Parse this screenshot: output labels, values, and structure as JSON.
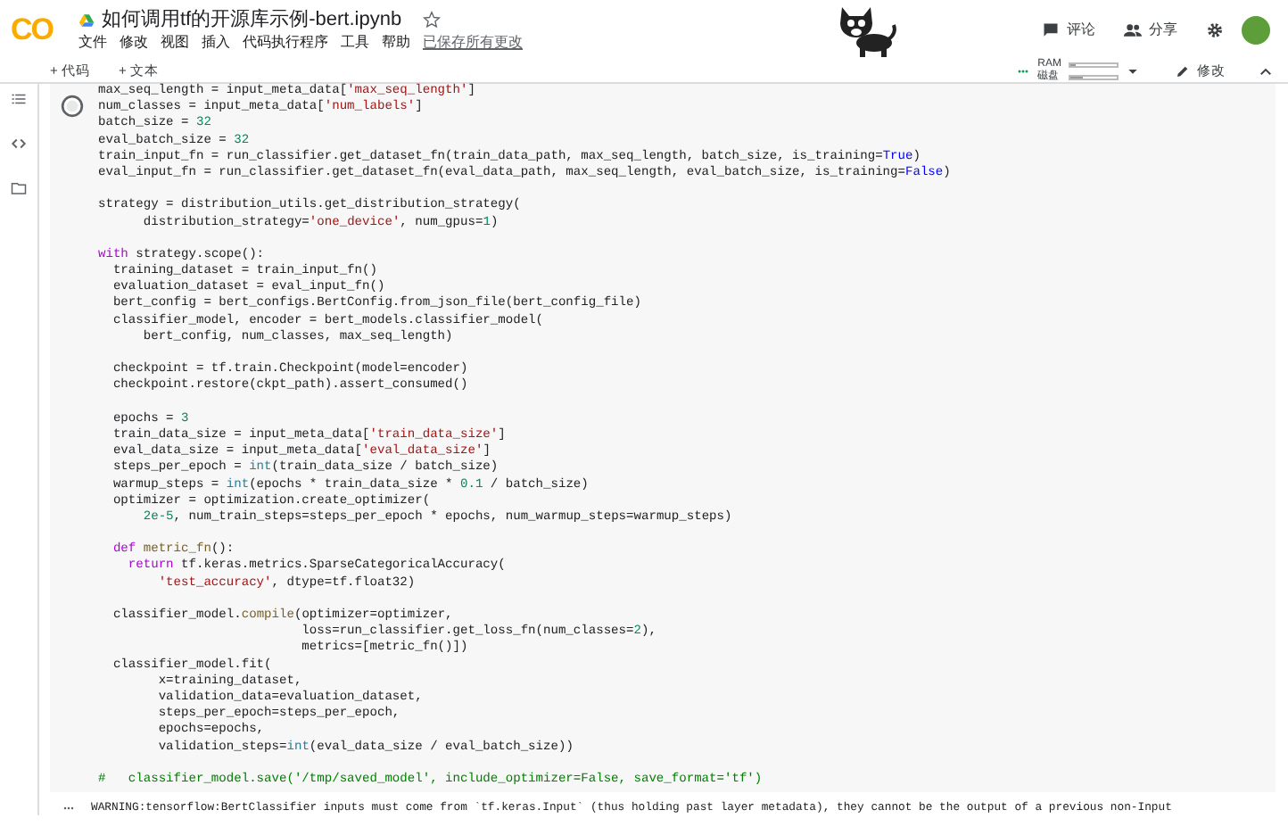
{
  "header": {
    "logo": "CO",
    "title": "如何调用tf的开源库示例-bert.ipynb",
    "starred": false,
    "menu": [
      "文件",
      "修改",
      "视图",
      "插入",
      "代码执行程序",
      "工具",
      "帮助"
    ],
    "save_status": "已保存所有更改",
    "actions": [
      "评论",
      "分享"
    ]
  },
  "toolbar": {
    "add": [
      "+ 代码",
      "+ 文本"
    ],
    "ram": {
      "label": "RAM",
      "level": 0.1
    },
    "disk": {
      "label": "磁盘",
      "level": 0.25
    },
    "edit": "修改"
  },
  "cell": {
    "blocks": [
      [
        [
          "max_seq_length = input_meta_data[",
          {
            "text": "'max_seq_length'",
            "kind": "str"
          },
          "]"
        ],
        [
          "num_classes = input_meta_data[",
          {
            "text": "'num_labels'",
            "kind": "str"
          },
          "]"
        ],
        [
          "batch_size = ",
          {
            "text": "32",
            "kind": "num"
          }
        ],
        [
          "eval_batch_size = ",
          {
            "text": "32",
            "kind": "num"
          }
        ],
        [
          "train_input_fn = run_classifier.get_dataset_fn(train_data_path, max_seq_length, batch_size, is_training=",
          {
            "text": "True",
            "kind": "const"
          },
          ")"
        ],
        [
          "eval_input_fn = run_classifier.get_dataset_fn(eval_data_path, max_seq_length, eval_batch_size, is_training=",
          {
            "text": "False",
            "kind": "const"
          },
          ")"
        ]
      ],
      [
        [
          "strategy = distribution_utils.get_distribution_strategy("
        ],
        [
          "      distribution_strategy=",
          {
            "text": "'one_device'",
            "kind": "str"
          },
          ", num_gpus=",
          {
            "text": "1",
            "kind": "num"
          },
          ")"
        ]
      ],
      [
        [
          {
            "text": "with",
            "kind": "kw"
          },
          " strategy.scope():"
        ],
        [
          "  training_dataset = train_input_fn()"
        ],
        [
          "  evaluation_dataset = eval_input_fn()"
        ],
        [
          "  bert_config = bert_configs.BertConfig.from_json_file(bert_config_file)"
        ],
        [
          "  classifier_model, encoder = bert_models.classifier_model("
        ],
        [
          "      bert_config, num_classes, max_seq_length)"
        ]
      ],
      [
        [
          "  checkpoint = tf.train.Checkpoint(model=encoder)"
        ],
        [
          "  checkpoint.restore(ckpt_path).assert_consumed()"
        ]
      ],
      [
        [
          "  epochs = ",
          {
            "text": "3",
            "kind": "num"
          }
        ],
        [
          "  train_data_size = input_meta_data[",
          {
            "text": "'train_data_size'",
            "kind": "str"
          },
          "]"
        ],
        [
          "  eval_data_size = input_meta_data[",
          {
            "text": "'eval_data_size'",
            "kind": "str"
          },
          "]"
        ],
        [
          "  steps_per_epoch = ",
          {
            "text": "int",
            "kind": "builtin"
          },
          "(train_data_size / batch_size)"
        ],
        [
          "  warmup_steps = ",
          {
            "text": "int",
            "kind": "builtin"
          },
          "(epochs * train_data_size * ",
          {
            "text": "0.1",
            "kind": "num"
          },
          " / batch_size)"
        ],
        [
          "  optimizer = optimization.create_optimizer("
        ],
        [
          {
            "text": "      2e-5",
            "kind": "num"
          },
          ", num_train_steps=steps_per_epoch * epochs, num_warmup_steps=warmup_steps)"
        ]
      ],
      [
        [
          {
            "text": "  def ",
            "kind": "kw"
          },
          {
            "text": "metric_fn",
            "kind": "fn"
          },
          "():"
        ],
        [
          {
            "text": "    return",
            "kind": "kw"
          },
          " tf.keras.metrics.SparseCategoricalAccuracy("
        ],
        [
          {
            "text": "        'test_accuracy'",
            "kind": "str"
          },
          ", dtype=tf.float32)"
        ]
      ],
      [
        [
          "  classifier_model.",
          {
            "text": "compile",
            "kind": "fn"
          },
          "(optimizer=optimizer,"
        ],
        [
          "                           loss=run_classifier.get_loss_fn(num_classes=",
          {
            "text": "2",
            "kind": "num"
          },
          "),"
        ],
        [
          "                           metrics=[metric_fn()])"
        ],
        [
          "  classifier_model.fit("
        ],
        [
          "        x=training_dataset,"
        ],
        [
          "        validation_data=evaluation_dataset,"
        ],
        [
          "        steps_per_epoch=steps_per_epoch,"
        ],
        [
          "        epochs=epochs,"
        ],
        [
          "        validation_steps=",
          {
            "text": "int",
            "kind": "builtin"
          },
          "(eval_data_size / eval_batch_size))"
        ]
      ],
      [
        [
          {
            "text": "#   classifier_model.save('/tmp/saved_model', include_optimizer=False, save_format='tf')",
            "kind": "comment"
          }
        ]
      ]
    ],
    "output": "WARNING:tensorflow:BertClassifier inputs must come from `tf.keras.Input` (thus holding past layer metadata), they cannot be the output of a previous non-Input"
  }
}
